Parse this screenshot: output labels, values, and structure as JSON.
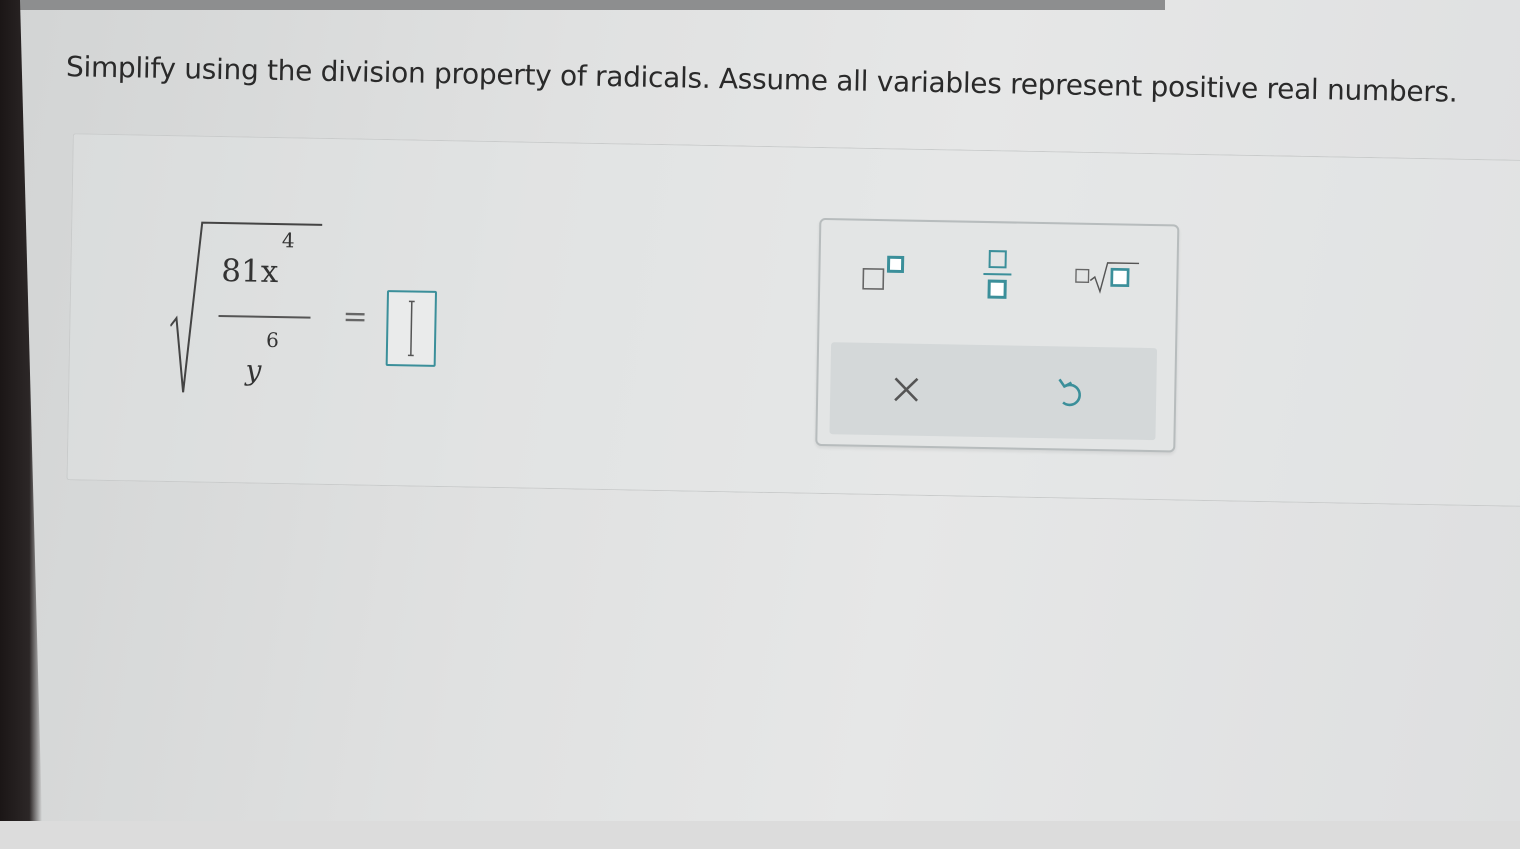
{
  "instruction": "Simplify using the division property of radicals. Assume all variables represent positive real numbers.",
  "expression": {
    "numerator": "81x",
    "numerator_exponent": "4",
    "denominator": "y",
    "denominator_exponent": "6",
    "equals": "="
  },
  "answer": {
    "value": ""
  },
  "palette": {
    "tools": [
      "exponent-icon",
      "fraction-icon",
      "nth-root-icon"
    ],
    "actions": [
      "clear-icon",
      "undo-icon"
    ]
  },
  "colors": {
    "accent": "#3b8f9a",
    "background": "#e0e1e1",
    "text": "#2a2a2a"
  }
}
